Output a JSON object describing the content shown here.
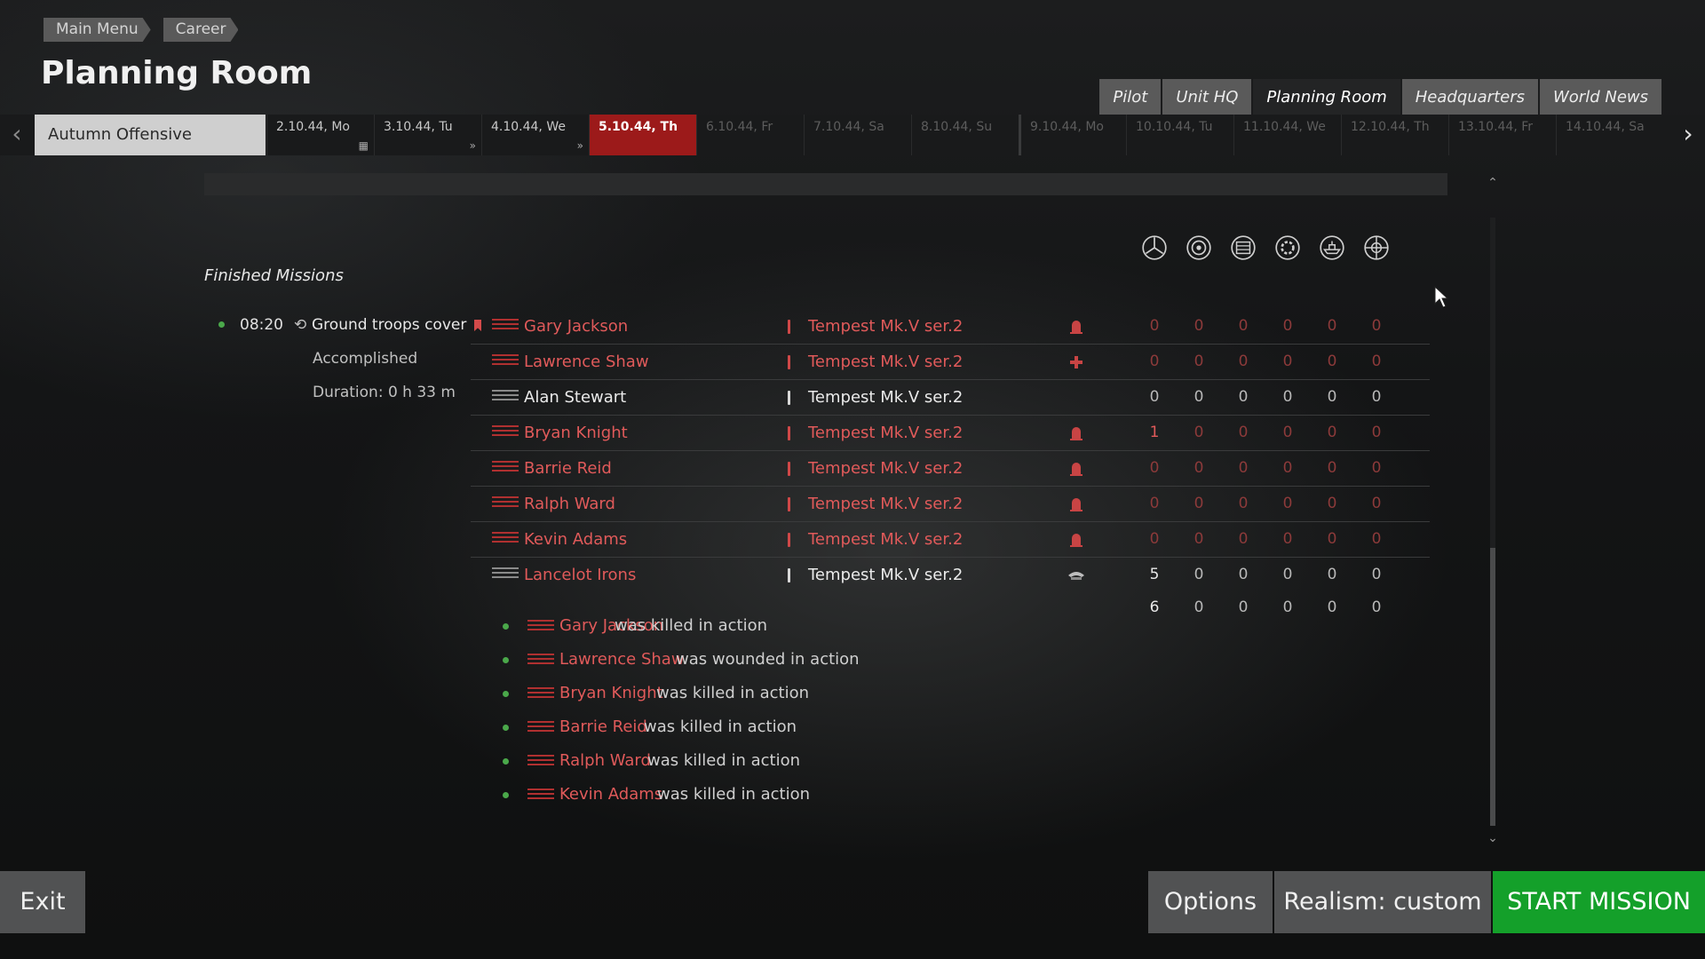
{
  "breadcrumb": [
    "Main Menu",
    "Career"
  ],
  "page_title": "Planning Room",
  "top_tabs": [
    {
      "label": "Pilot"
    },
    {
      "label": "Unit HQ"
    },
    {
      "label": "Planning Room"
    },
    {
      "label": "Headquarters"
    },
    {
      "label": "World News"
    }
  ],
  "active_tab": "Planning Room",
  "timeline": {
    "campaign": "Autumn Offensive",
    "days": [
      {
        "label": "2.10.44, Mo",
        "state": "past"
      },
      {
        "label": "3.10.44, Tu",
        "state": "past"
      },
      {
        "label": "4.10.44, We",
        "state": "past"
      },
      {
        "label": "5.10.44, Th",
        "state": "current"
      },
      {
        "label": "6.10.44, Fr",
        "state": "future"
      },
      {
        "label": "7.10.44, Sa",
        "state": "future"
      },
      {
        "label": "8.10.44, Su",
        "state": "future"
      },
      {
        "label": "9.10.44, Mo",
        "state": "future"
      },
      {
        "label": "10.10.44, Tu",
        "state": "future"
      },
      {
        "label": "11.10.44, We",
        "state": "future"
      },
      {
        "label": "12.10.44, Th",
        "state": "future"
      },
      {
        "label": "13.10.44, Fr",
        "state": "future"
      },
      {
        "label": "14.10.44, Sa",
        "state": "future"
      }
    ]
  },
  "section": {
    "title": "Finished Missions",
    "mission": {
      "time": "08:20",
      "type": "Ground troops cover",
      "status": "Accomplished",
      "duration": "Duration: 0 h 33 m"
    }
  },
  "stat_icons": [
    "aircraft-kills-icon",
    "ground-target-icon",
    "armor-target-icon",
    "artillery-target-icon",
    "ship-target-icon",
    "objective-target-icon"
  ],
  "pilots": [
    {
      "name": "Gary Jackson",
      "plane": "Tempest Mk.V ser.2",
      "state": "dead",
      "status_icon": "tombstone-icon",
      "stats": [
        "0",
        "0",
        "0",
        "0",
        "0",
        "0"
      ],
      "flag": true,
      "rank_gray": false
    },
    {
      "name": "Lawrence Shaw",
      "plane": "Tempest Mk.V ser.2",
      "state": "wounded",
      "status_icon": "medical-cross-icon",
      "stats": [
        "0",
        "0",
        "0",
        "0",
        "0",
        "0"
      ],
      "flag": false,
      "rank_gray": false
    },
    {
      "name": "Alan Stewart",
      "plane": "Tempest Mk.V ser.2",
      "state": "ok",
      "status_icon": "",
      "stats": [
        "0",
        "0",
        "0",
        "0",
        "0",
        "0"
      ],
      "flag": false,
      "rank_gray": true
    },
    {
      "name": "Bryan Knight",
      "plane": "Tempest Mk.V ser.2",
      "state": "dead",
      "status_icon": "tombstone-icon",
      "stats": [
        "1",
        "0",
        "0",
        "0",
        "0",
        "0"
      ],
      "flag": false,
      "rank_gray": false
    },
    {
      "name": "Barrie Reid",
      "plane": "Tempest Mk.V ser.2",
      "state": "dead",
      "status_icon": "tombstone-icon",
      "stats": [
        "0",
        "0",
        "0",
        "0",
        "0",
        "0"
      ],
      "flag": false,
      "rank_gray": false
    },
    {
      "name": "Ralph Ward",
      "plane": "Tempest Mk.V ser.2",
      "state": "dead",
      "status_icon": "tombstone-icon",
      "stats": [
        "0",
        "0",
        "0",
        "0",
        "0",
        "0"
      ],
      "flag": false,
      "rank_gray": false
    },
    {
      "name": "Kevin Adams",
      "plane": "Tempest Mk.V ser.2",
      "state": "dead",
      "status_icon": "tombstone-icon",
      "stats": [
        "0",
        "0",
        "0",
        "0",
        "0",
        "0"
      ],
      "flag": false,
      "rank_gray": false
    },
    {
      "name": "Lancelot Irons",
      "plane": "Tempest Mk.V ser.2",
      "state": "self",
      "status_icon": "pilot-cap-icon",
      "stats": [
        "5",
        "0",
        "0",
        "0",
        "0",
        "0"
      ],
      "flag": false,
      "rank_gray": true
    }
  ],
  "totals": [
    "6",
    "0",
    "0",
    "0",
    "0",
    "0"
  ],
  "casualties": [
    {
      "name": "Gary Jackson",
      "text": "was killed in action"
    },
    {
      "name": "Lawrence Shaw",
      "text": "was wounded in action"
    },
    {
      "name": "Bryan Knight",
      "text": "was killed in action"
    },
    {
      "name": "Barrie Reid",
      "text": "was killed in action"
    },
    {
      "name": "Ralph Ward",
      "text": "was killed in action"
    },
    {
      "name": "Kevin Adams",
      "text": "was killed in action"
    }
  ],
  "footer": {
    "exit": "Exit",
    "options": "Options",
    "realism": "Realism: custom",
    "start": "START MISSION"
  }
}
